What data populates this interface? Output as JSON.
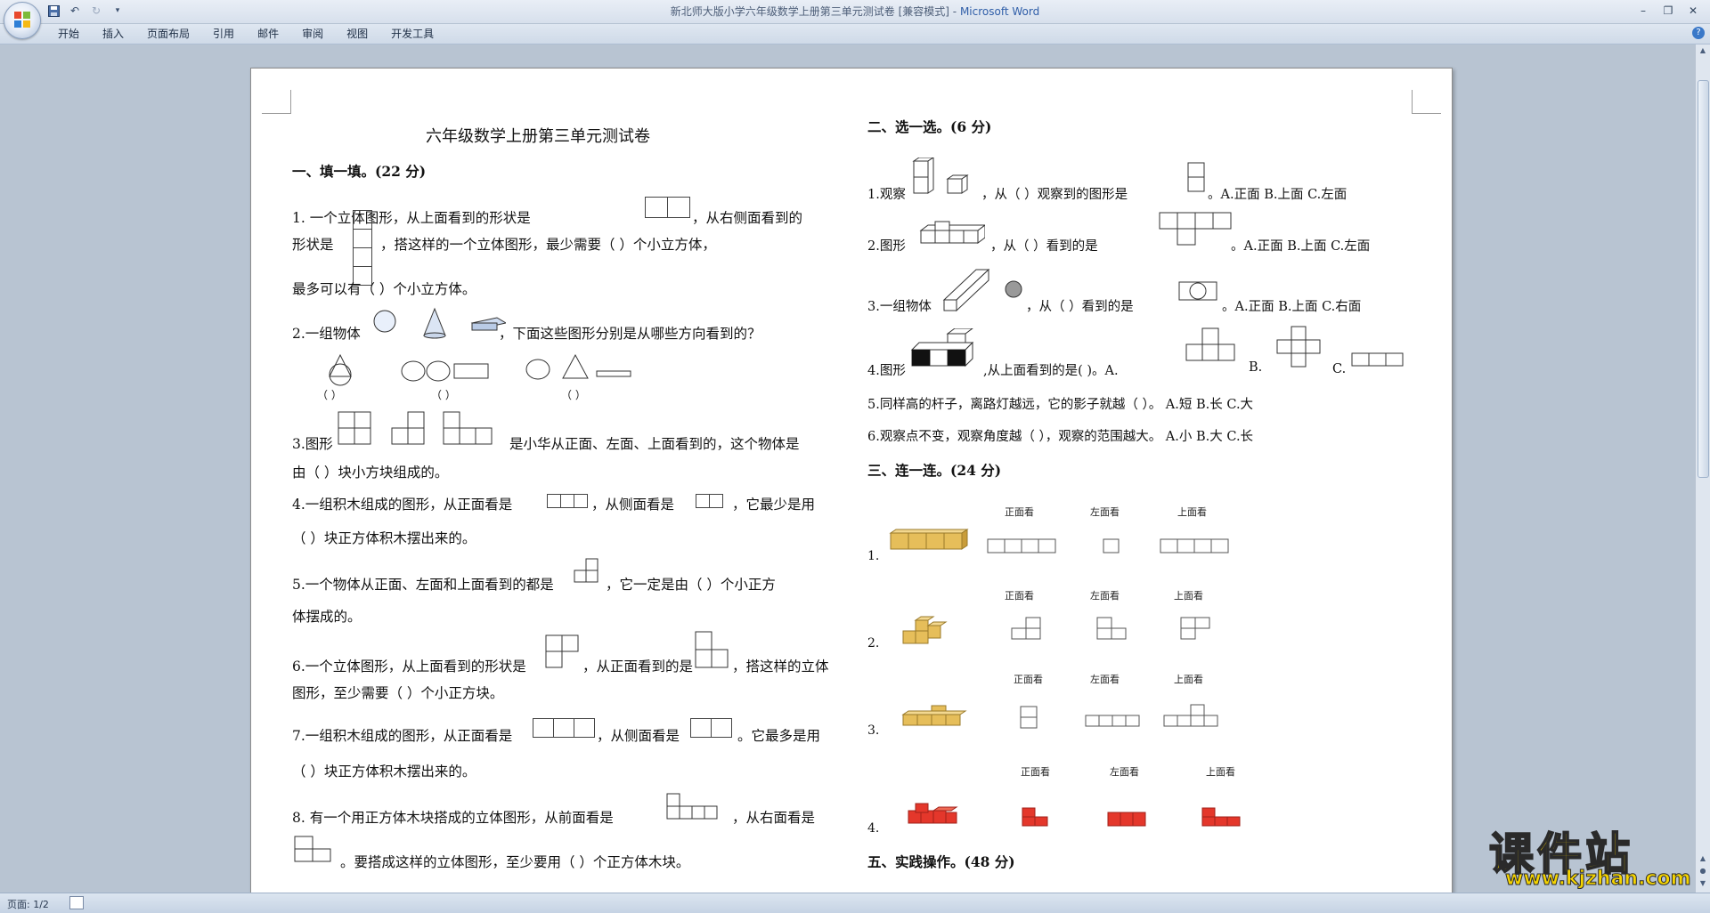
{
  "window": {
    "title_doc": "新北师大版小学六年级数学上册第三单元测试卷 [兼容模式]",
    "title_sep": " - ",
    "title_app": "Microsoft Word"
  },
  "ribbon": {
    "tabs": [
      "开始",
      "插入",
      "页面布局",
      "引用",
      "邮件",
      "审阅",
      "视图",
      "开发工具"
    ]
  },
  "statusbar": {
    "page": "页面: 1/2"
  },
  "watermark": {
    "brand": "课件站",
    "url": "www.kjzhan.com"
  },
  "doc": {
    "title": "六年级数学上册第三单元测试卷",
    "s1": "一、填一填。(22 分)",
    "q1a": "1.        一个立体图形，从上面看到的形状是",
    "q1b": "，从右侧面看到的",
    "q1c": "形状是",
    "q1d": "，搭这样的一个立体图形，最少需要（      ）个小立方体，",
    "q1e": "最多可以有（      ）个小立方体。",
    "q2a": "2.一组物体",
    "q2b": "，下面这些图形分别是从哪些方向看到的？",
    "q2p1": "（      ）",
    "q2p2": "（      ）",
    "q2p3": "（      ）",
    "q3a": "3.图形",
    "q3b": "是小华从正面、左面、上面看到的，这个物体是",
    "q3c": "由（      ）块小方块组成的。",
    "q4a": "4.一组积木组成的图形，从正面看是",
    "q4b": "，从侧面看是",
    "q4c": "，它最少是用",
    "q4d": "（      ）块正方体积木摆出来的。",
    "q5a": "5.一个物体从正面、左面和上面看到的都是",
    "q5b": "，它一定是由（        ）个小正方",
    "q5c": "体摆成的。",
    "q6a": "6.一个立体图形，从上面看到的形状是",
    "q6b": "，从正面看到的是",
    "q6c": "，搭这样的立体",
    "q6d": "图形，至少需要（      ）个小正方块。",
    "q7a": "7.一组积木组成的图形，从正面看是",
    "q7b": "，从侧面看是",
    "q7c": "。它最多是用",
    "q7d": "（       ）块正方体积木摆出来的。",
    "q8a": "8. 有一个用正方体木块搭成的立体图形，从前面看是",
    "q8b": "，从右面看是",
    "q8c": "。要搭成这样的立体图形，至少要用（       ）个正方体木块。",
    "s2": "二、选一选。(6 分)",
    "c1a": "1.观察",
    "c1b": "，从（        ）观察到的图形是",
    "c1c": "。A.正面    B.上面     C.左面",
    "c2a": "2.图形",
    "c2b": "，从（        ）看到的是",
    "c2c": "。A.正面  B.上面   C.左面",
    "c3a": "3.一组物体",
    "c3b": "，从（      ）看到的是",
    "c3c": "。A.正面  B.上面   C.右面",
    "c4a": "4.图形",
    "c4b": ",从上面看到的是(       )。A.",
    "c4c": "B.",
    "c4d": "C.",
    "c5": "5.同样高的杆子，离路灯越远，它的影子就越（        ）。 A.短     B.长      C.大",
    "c6": "6.观察点不变，观察角度越（        ），观察的范围越大。  A.小   B.大     C.长",
    "s3": "三、连一连。(24 分)",
    "view_front": "正面看",
    "view_left": "左面看",
    "view_top": "上面看",
    "l1": "1.",
    "l2": "2.",
    "l3": "3.",
    "l4": "4.",
    "s5": "五、实践操作。(48 分)"
  }
}
